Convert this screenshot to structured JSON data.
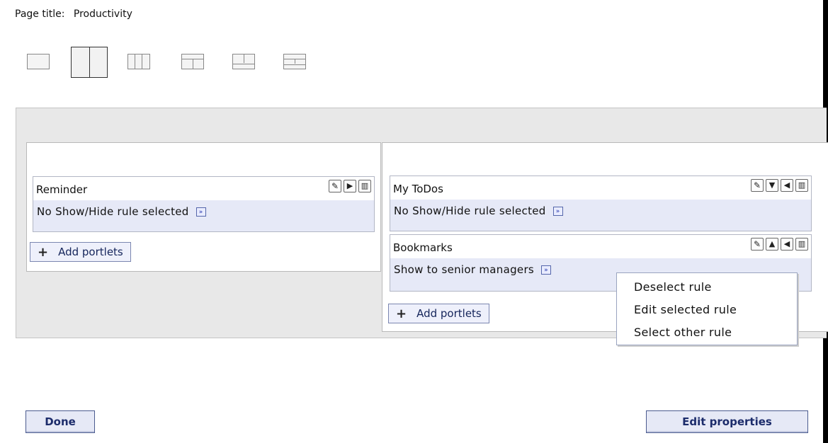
{
  "page": {
    "title_label": "Page title:",
    "title_value": "Productivity"
  },
  "layouts": [
    "one-column",
    "two-column",
    "three-column",
    "top-two-column",
    "two-column-bottom",
    "top-two-bottom"
  ],
  "left_column": {
    "portlets": [
      {
        "name": "Reminder",
        "rule": "No Show/Hide rule selected",
        "tools": [
          "edit-icon",
          "arrow-right-icon",
          "trash-icon"
        ]
      }
    ],
    "add_label": "Add portlets"
  },
  "right_column": {
    "portlets": [
      {
        "name": "My ToDos",
        "rule": "No Show/Hide rule selected",
        "tools": [
          "edit-icon",
          "arrow-down-icon",
          "arrow-left-icon",
          "trash-icon"
        ]
      },
      {
        "name": "Bookmarks",
        "rule": "Show to senior managers",
        "tools": [
          "edit-icon",
          "arrow-up-icon",
          "arrow-left-icon",
          "trash-icon"
        ]
      }
    ],
    "add_label": "Add portlets"
  },
  "context_menu": {
    "items": [
      "Deselect rule",
      "Edit selected rule",
      "Select other rule"
    ]
  },
  "footer": {
    "done": "Done",
    "edit_properties": "Edit properties"
  }
}
